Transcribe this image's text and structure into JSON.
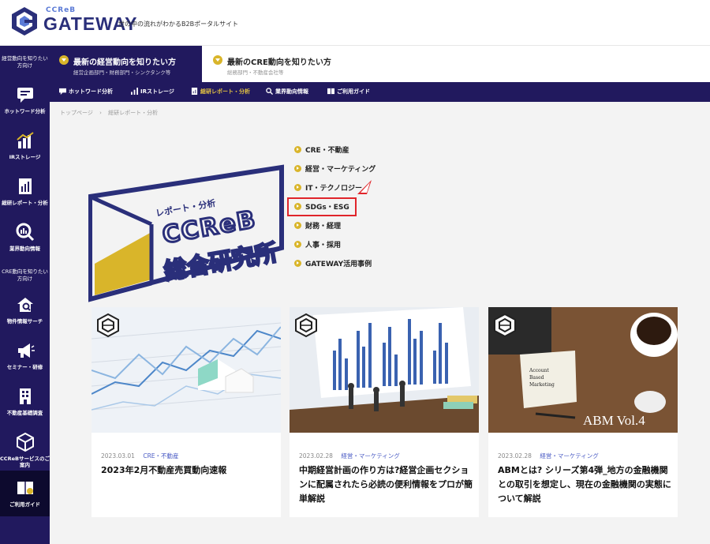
{
  "header": {
    "logo_small": "CCReB",
    "logo_main": "GATEWAY",
    "tagline": "世の中の流れがわかるB2Bポータルサイト"
  },
  "sidebar": {
    "group1": "経営動向を知りたい方向け",
    "group2": "CRE動向を知りたい方向け",
    "items": [
      {
        "label": "ホットワード分析",
        "icon": "chat-icon"
      },
      {
        "label": "IRストレージ",
        "icon": "bar-chart-icon"
      },
      {
        "label": "総研レポート・分析",
        "icon": "report-icon"
      },
      {
        "label": "業界動向情報",
        "icon": "search-chart-icon"
      },
      {
        "label": "物件情報サーチ",
        "icon": "house-search-icon"
      },
      {
        "label": "セミナー・研修",
        "icon": "megaphone-icon"
      },
      {
        "label": "不動産基礎調査",
        "icon": "building-icon"
      },
      {
        "label": "CCReBサービスのご案内",
        "icon": "cube-icon"
      },
      {
        "label": "ご利用ガイド",
        "icon": "guide-book-icon"
      }
    ]
  },
  "tabs": [
    {
      "title": "最新の経営動向を知りたい方",
      "sub": "経営企画部門・財務部門・シンクタンク等"
    },
    {
      "title": "最新のCRE動向を知りたい方",
      "sub": "総務部門・不動産会社等"
    }
  ],
  "nav": [
    {
      "label": "ホットワード分析"
    },
    {
      "label": "IRストレージ"
    },
    {
      "label": "総研レポート・分析"
    },
    {
      "label": "業界動向情報"
    },
    {
      "label": "ご利用ガイド"
    }
  ],
  "breadcrumb": {
    "home": "トップページ",
    "sep": "›",
    "current": "総研レポート・分析"
  },
  "hero": {
    "subtitle": "レポート・分析",
    "brand": "CCReB",
    "title": "総合研究所"
  },
  "categories": [
    "CRE・不動産",
    "経営・マーケティング",
    "IT・テクノロジー",
    "SDGs・ESG",
    "財務・経理",
    "人事・採用",
    "GATEWAY活用事例"
  ],
  "cards": [
    {
      "date": "2023.03.01",
      "category": "CRE・不動産",
      "title": "2023年2月不動産売買動向速報"
    },
    {
      "date": "2023.02.28",
      "category": "経営・マーケティング",
      "title": "中期経営計画の作り方は?経営企画セクションに配属されたら必読の便利情報をプロが簡単解説"
    },
    {
      "date": "2023.02.28",
      "category": "経営・マーケティング",
      "title": "ABMとは? シリーズ第4弾_地方の金融機関との取引を想定し、現在の金融機関の実態について解説",
      "image_text": "ABM  Vol.4",
      "note": [
        "Account",
        "Based",
        "Marketing"
      ]
    }
  ],
  "colors": {
    "navy": "#21195e",
    "gold": "#d9b52a",
    "red": "#e0252b",
    "link": "#4a5bc4"
  }
}
